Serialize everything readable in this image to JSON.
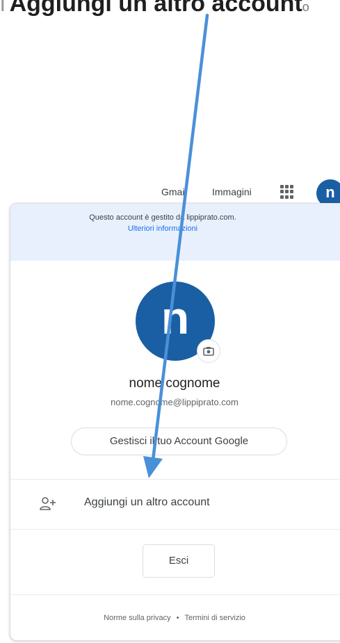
{
  "caption": {
    "lead": "i",
    "text": "Aggiungi un altro account",
    "tail": "o"
  },
  "topbar": {
    "gmail_label": "Gmail",
    "images_label": "Immagini",
    "apps_icon": "apps-grid-icon",
    "avatar_letter": "n"
  },
  "card": {
    "managed_notice": "Questo account è gestito da lippiprato.com.",
    "learn_more": "Ulteriori informazioni",
    "avatar_letter": "n",
    "camera_icon": "camera-icon",
    "name": "nome cognome",
    "email": "nome.cognome@lippiprato.com",
    "manage_label": "Gestisci il tuo Account Google",
    "add_account_icon": "person-add-icon",
    "add_account_label": "Aggiungi un altro account",
    "logout_label": "Esci",
    "privacy_label": "Norme sulla privacy",
    "separator": "•",
    "terms_label": "Termini di servizio"
  },
  "colors": {
    "avatar": "#1a5fa3",
    "notice_bg": "#e8f0fe",
    "link": "#1a73e8",
    "annotation_arrow": "#4a90d9"
  }
}
